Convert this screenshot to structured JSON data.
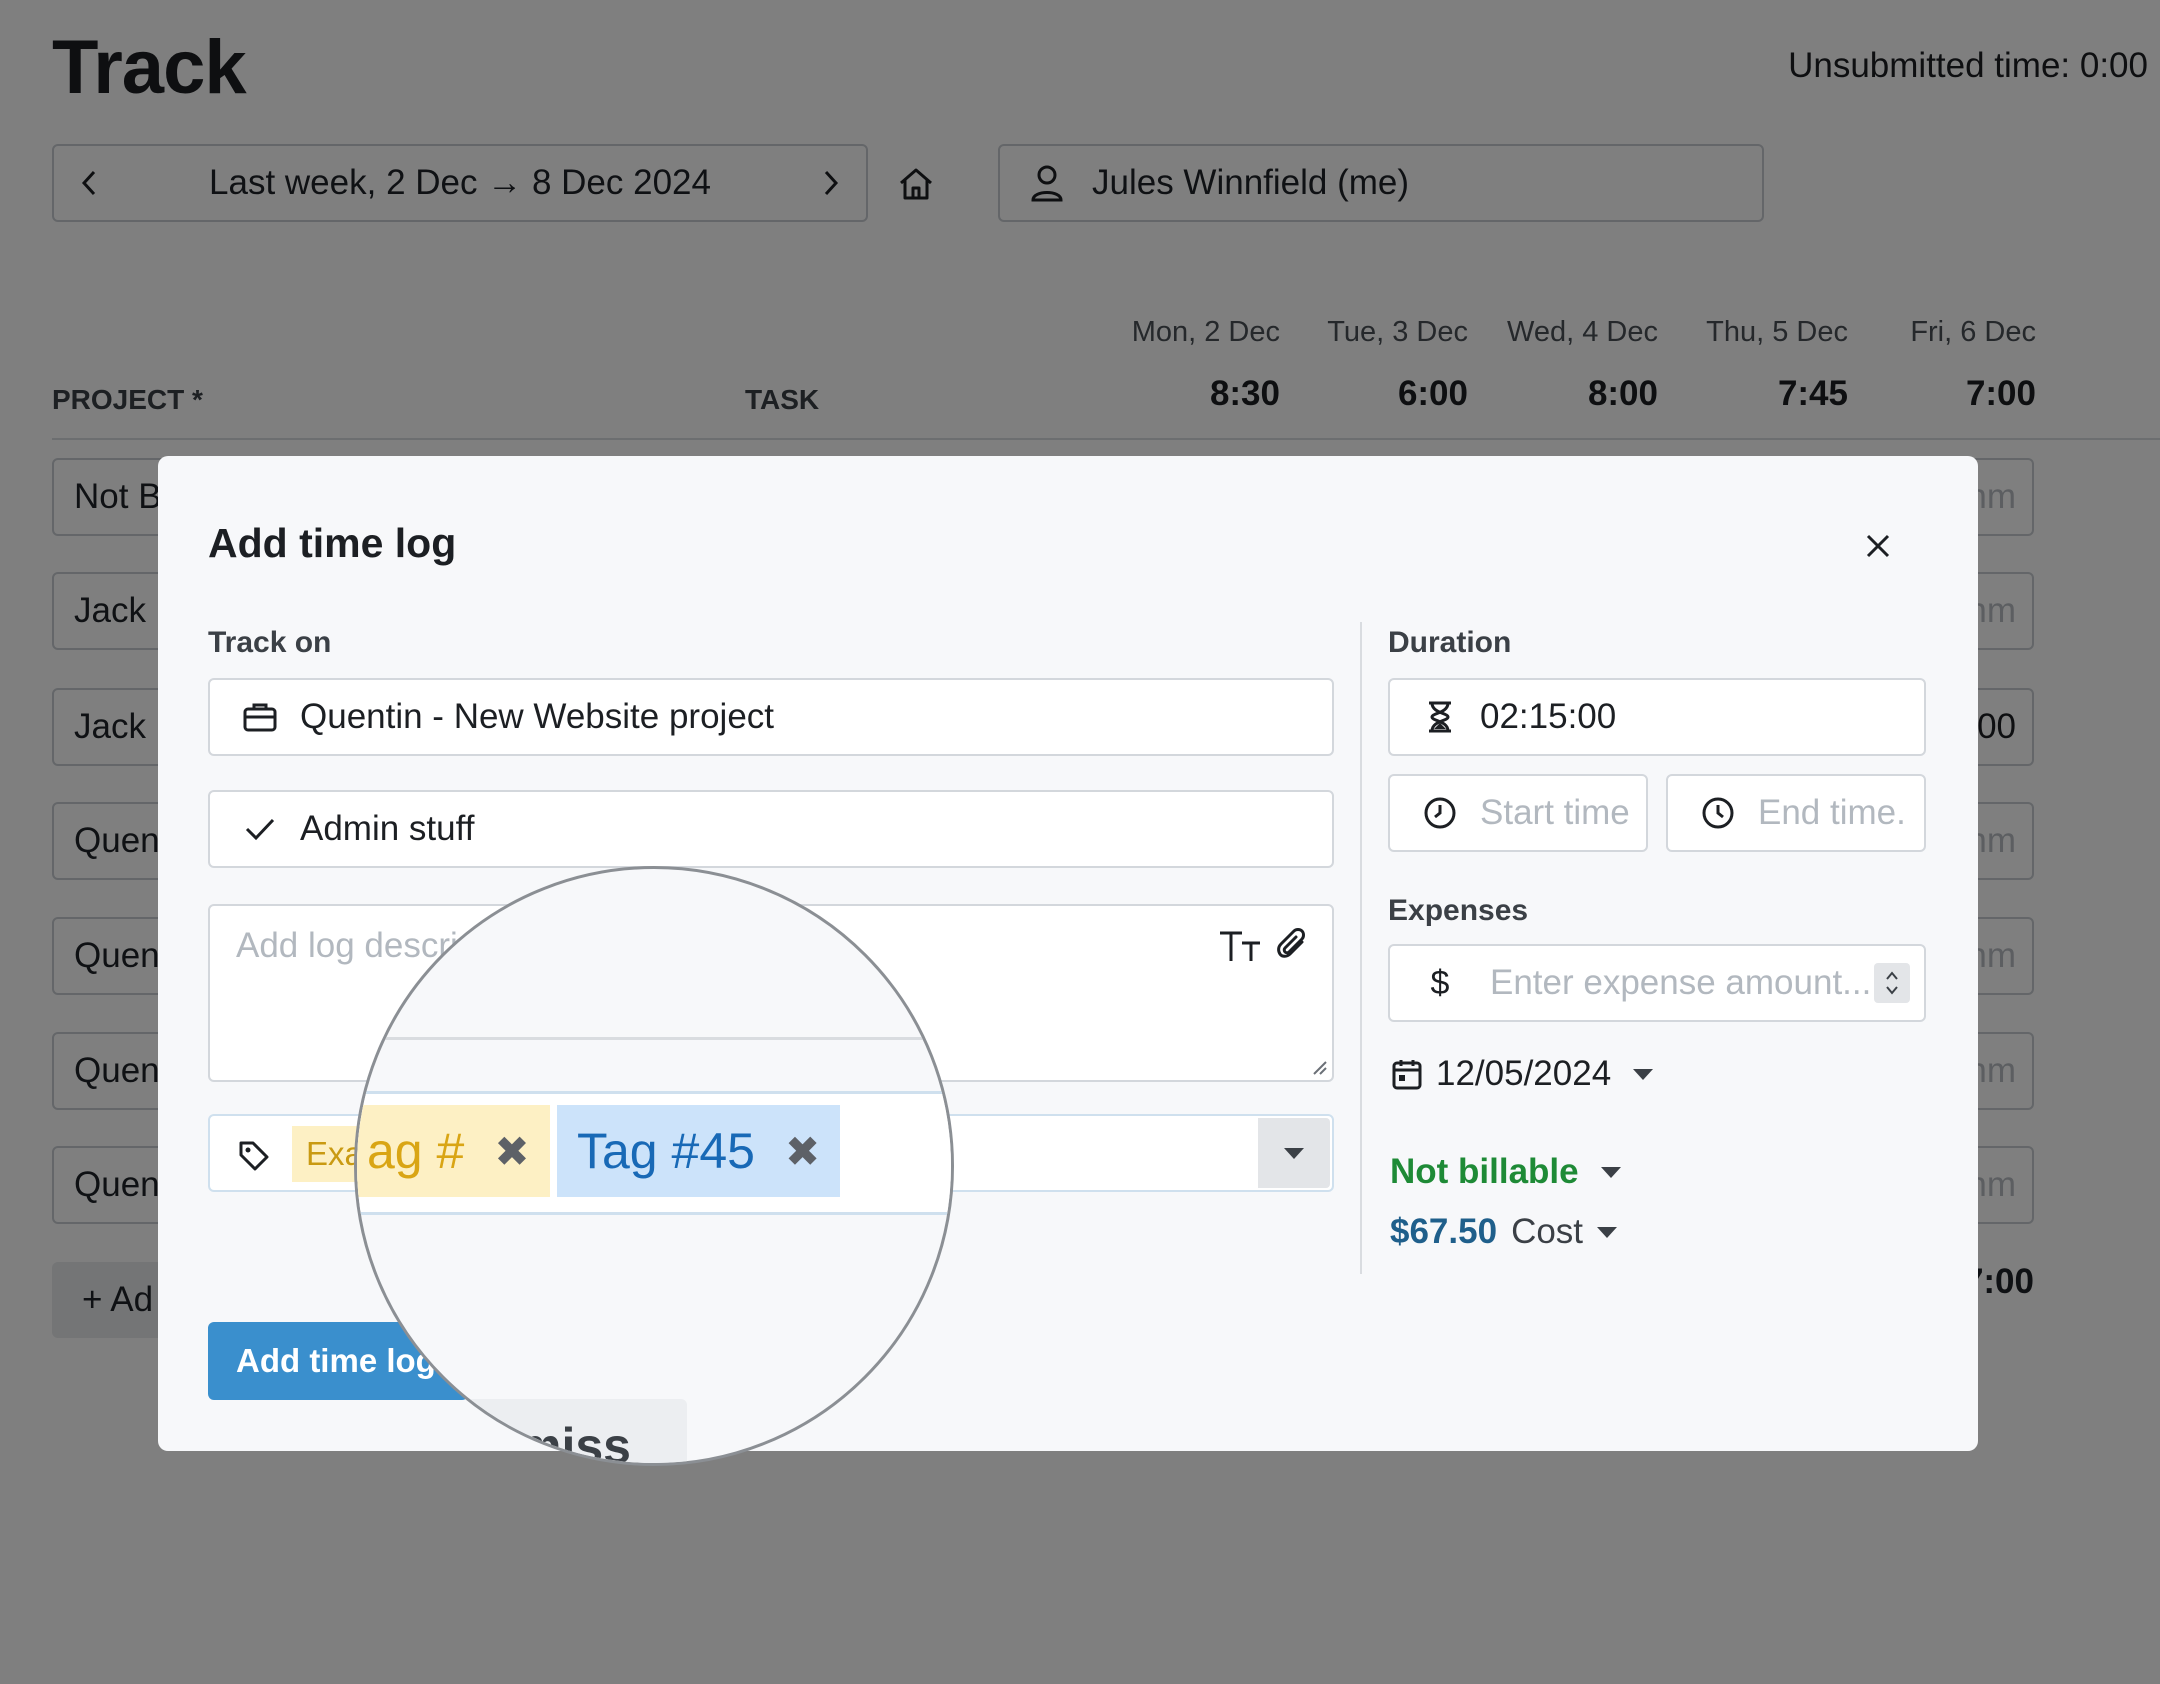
{
  "page": {
    "title": "Track",
    "unsubmitted": "Unsubmitted time: 0:00",
    "week_label": "Last week, 2 Dec → 8 Dec 2024",
    "user": "Jules Winnfield (me)",
    "columns": {
      "project": "PROJECT *",
      "task": "TASK"
    },
    "days": [
      {
        "label": "Mon, 2 Dec",
        "total": "8:30"
      },
      {
        "label": "Tue, 3 Dec",
        "total": "6:00"
      },
      {
        "label": "Wed, 4 Dec",
        "total": "8:00"
      },
      {
        "label": "Thu, 5 Dec",
        "total": "7:45"
      },
      {
        "label": "Fri, 6 Dec",
        "total": "7:00"
      }
    ],
    "rows": [
      {
        "project": "Not B",
        "cell": "hm"
      },
      {
        "project": "Jack",
        "cell": "hm"
      },
      {
        "project": "Jack",
        "cell": "00"
      },
      {
        "project": "Quen",
        "cell": "hm"
      },
      {
        "project": "Quen",
        "cell": "hm"
      },
      {
        "project": "Quen",
        "cell": "hm"
      },
      {
        "project": "Quen",
        "cell": "hm"
      }
    ],
    "add_row": "+ Ad",
    "grand_total": "7:00"
  },
  "modal": {
    "title": "Add time log",
    "track_on_label": "Track on",
    "project_value": "Quentin - New Website project",
    "task_value": "Admin stuff",
    "description_placeholder": "Add log descri                          ch...",
    "tag_small": "Exa",
    "submit_label": "Add time log",
    "duration_label": "Duration",
    "duration_value": "02:15:00",
    "start_placeholder": "Start time",
    "end_placeholder": "End time.",
    "expenses_label": "Expenses",
    "expense_currency": "$",
    "expense_placeholder": "Enter expense amount...",
    "date": "12/05/2024",
    "billable": "Not billable",
    "cost_amount": "$67.50",
    "cost_label": "Cost"
  },
  "magnifier": {
    "tags": [
      {
        "label": "ag #",
        "color": "#fdf0c4"
      },
      {
        "label": "Tag #45",
        "color": "#cce3fa"
      }
    ],
    "dismiss_partial": "miss"
  },
  "colors": {
    "accent": "#3a8fcd",
    "billable": "#1e8a36",
    "cost": "#1f5f8b"
  }
}
